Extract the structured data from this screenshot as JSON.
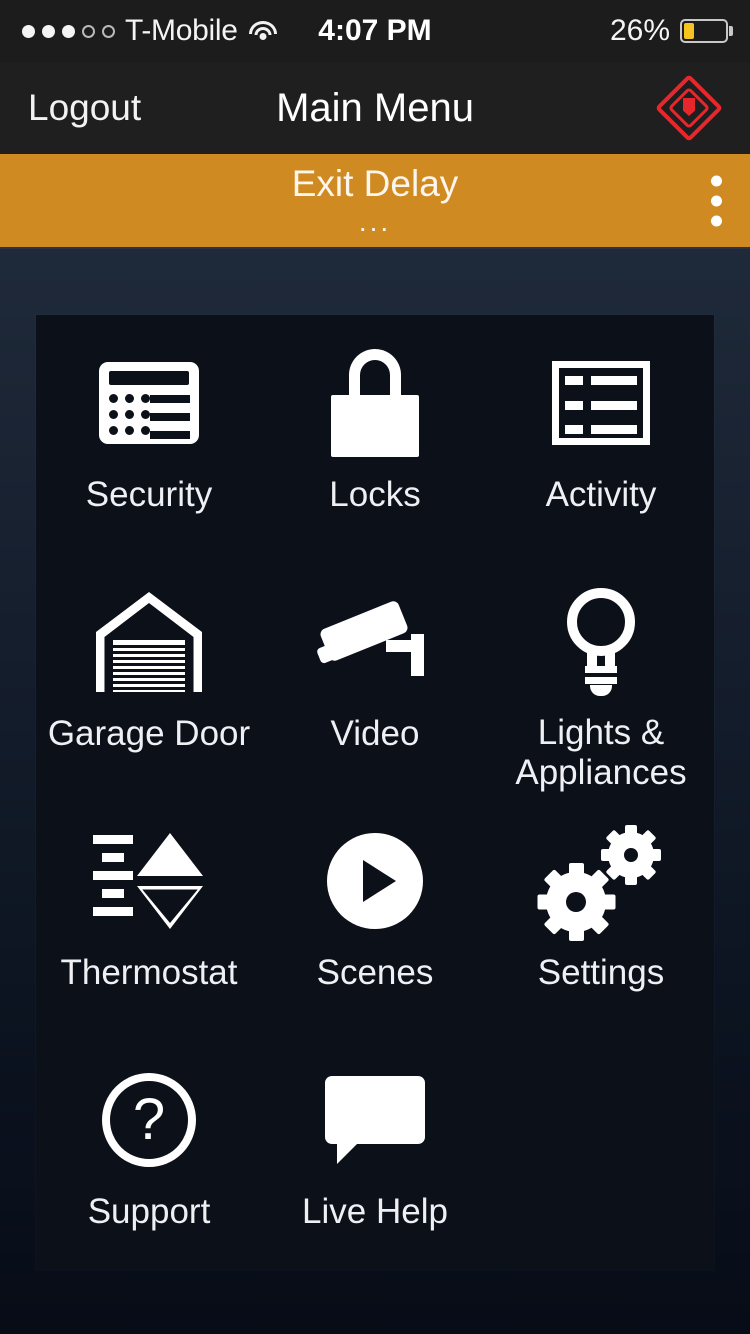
{
  "status_bar": {
    "signal_dots_filled": 3,
    "signal_dots_total": 5,
    "carrier": "T-Mobile",
    "wifi_icon": "wifi-icon",
    "time": "4:07 PM",
    "battery_percent_label": "26%",
    "battery_level": 26,
    "battery_color": "#f7c320"
  },
  "nav_bar": {
    "logout_label": "Logout",
    "title": "Main Menu",
    "panic_icon": "panic-alarm-icon",
    "panic_color": "#e8272c"
  },
  "banner": {
    "title": "Exit Delay",
    "subtitle": "...",
    "background_color": "#cf8a22",
    "menu_icon": "kebab-menu-icon"
  },
  "menu": {
    "items": [
      {
        "label": "Security",
        "icon": "keypad-icon"
      },
      {
        "label": "Locks",
        "icon": "padlock-icon"
      },
      {
        "label": "Activity",
        "icon": "list-icon"
      },
      {
        "label": "Garage Door",
        "icon": "garage-door-icon"
      },
      {
        "label": "Video",
        "icon": "security-camera-icon"
      },
      {
        "label": "Lights &\nAppliances",
        "icon": "lightbulb-icon"
      },
      {
        "label": "Thermostat",
        "icon": "thermostat-icon"
      },
      {
        "label": "Scenes",
        "icon": "play-circle-icon"
      },
      {
        "label": "Settings",
        "icon": "gears-icon"
      },
      {
        "label": "Support",
        "icon": "question-circle-icon"
      },
      {
        "label": "Live Help",
        "icon": "chat-bubble-icon"
      }
    ]
  },
  "theme": {
    "panel_background": "#0b1019",
    "page_background_top": "#242e3e",
    "page_background_bottom": "#070c17",
    "text_color": "#eef0f3"
  }
}
